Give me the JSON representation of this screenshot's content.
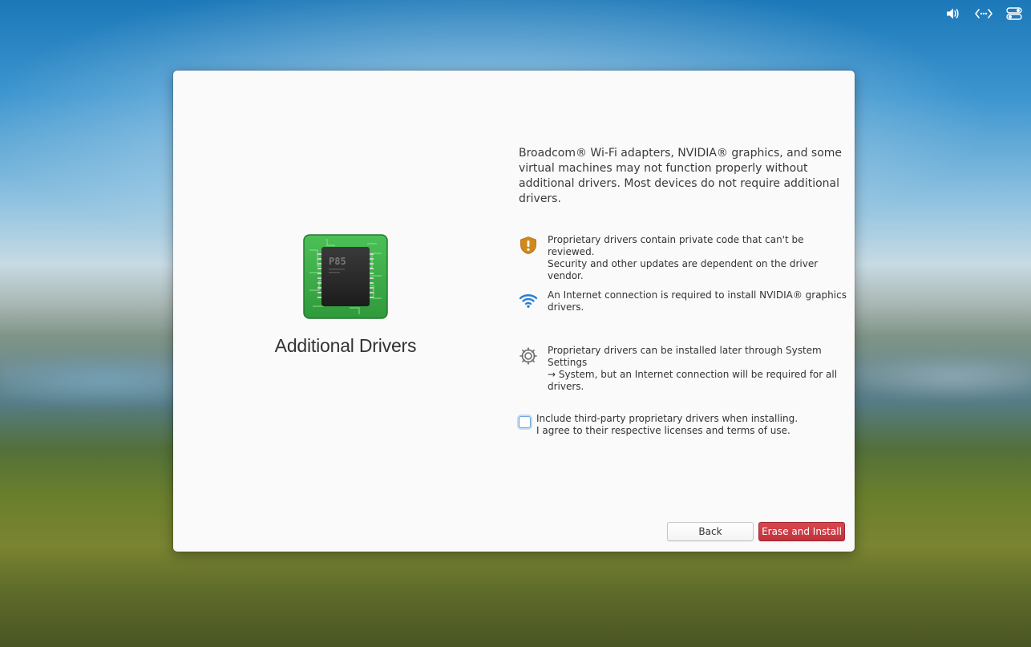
{
  "tray": {
    "icons": [
      "volume-icon",
      "network-icon",
      "settings-toggle-icon"
    ]
  },
  "dialog": {
    "title": "Additional Drivers",
    "chip_label": "P85",
    "intro": "Broadcom® Wi-Fi adapters, NVIDIA® graphics, and some virtual machines may not function properly without additional drivers. Most devices do not require additional drivers.",
    "notes": [
      {
        "icon": "shield-warning-icon",
        "line1": "Proprietary drivers contain private code that can't be reviewed.",
        "line2": "Security and other updates are dependent on the driver vendor."
      },
      {
        "icon": "wifi-icon",
        "line1": "An Internet connection is required to install NVIDIA® graphics",
        "line2": "drivers."
      },
      {
        "icon": "gear-icon",
        "line1": "Proprietary drivers can be installed later through System Settings",
        "line2": "→ System, but an Internet connection will be required for all",
        "line3": "drivers."
      }
    ],
    "consent": {
      "checked": false,
      "line1": "Include third-party proprietary drivers when installing.",
      "line2": "I agree to their respective licenses and terms of use."
    },
    "buttons": {
      "back": "Back",
      "install": "Erase and Install"
    }
  },
  "colors": {
    "accent_red": "#c8363f",
    "warning_orange": "#d08a1a",
    "wifi_blue": "#2a7fd4",
    "chip_green": "#3fae4a"
  }
}
